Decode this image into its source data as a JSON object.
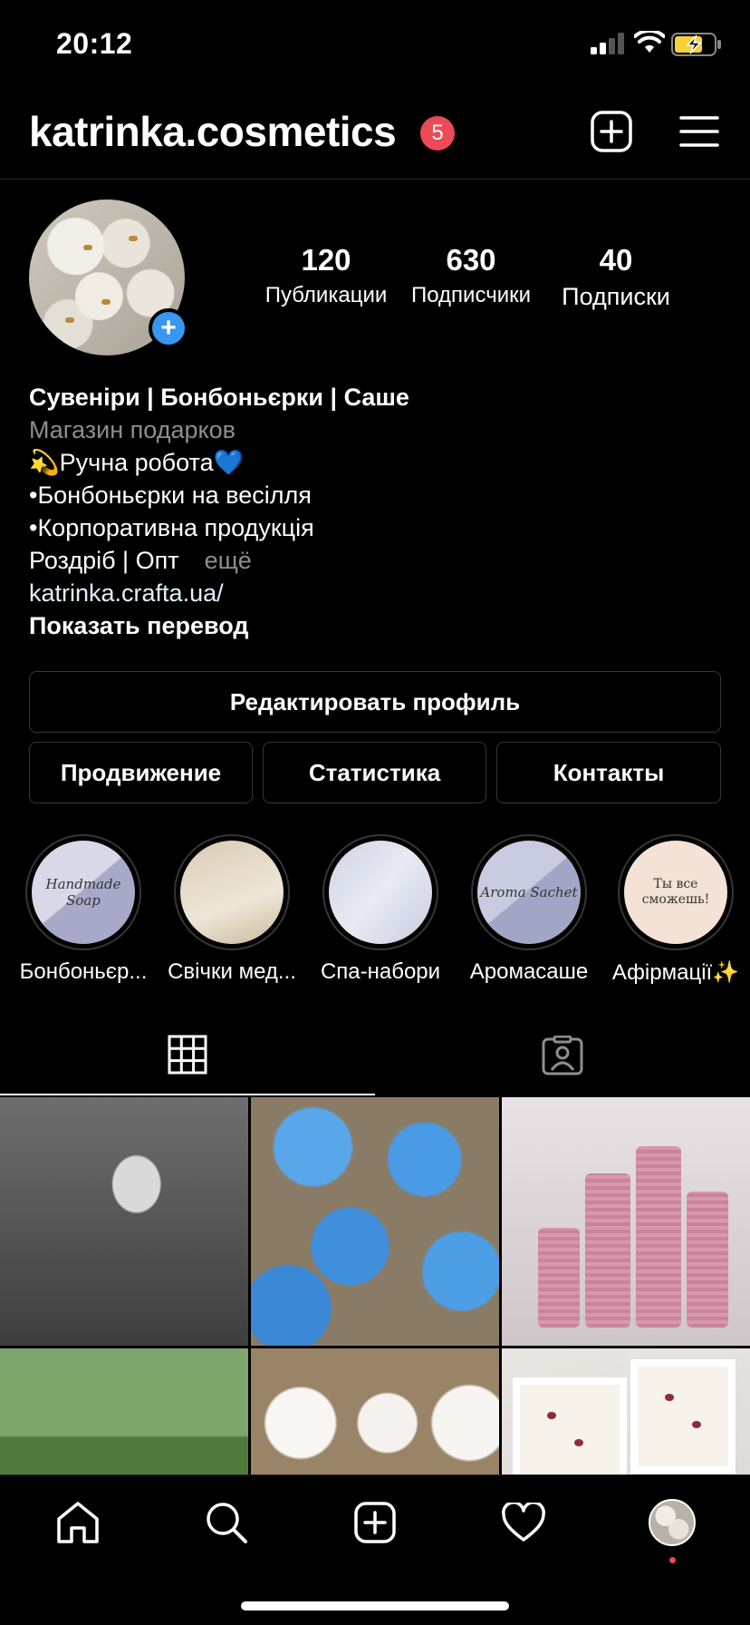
{
  "status_bar": {
    "time": "20:12"
  },
  "header": {
    "username": "katrinka.cosmetics",
    "notification_count": "5"
  },
  "stats": [
    {
      "value": "120",
      "label": "Публикации"
    },
    {
      "value": "630",
      "label": "Подписчики"
    },
    {
      "value": "40",
      "label": "Подписки"
    }
  ],
  "bio": {
    "name": "Сувеніри | Бонбоньєрки | Саше",
    "category": "Магазин подарков",
    "lines": [
      "💫Ручна робота💙",
      "•Бонбоньєрки на весілля",
      "•Корпоративна продукція",
      "Роздріб | Опт"
    ],
    "more": "ещё",
    "link": "katrinka.crafta.ua/",
    "translate": "Показать перевод"
  },
  "buttons": {
    "edit_profile": "Редактировать профиль",
    "promotion": "Продвижение",
    "statistics": "Статистика",
    "contacts": "Контакты"
  },
  "highlights": [
    {
      "label": "Бонбоньєр...",
      "cover_text": "Handmade Soap"
    },
    {
      "label": "Свічки мед...",
      "cover_text": ""
    },
    {
      "label": "Спа-набори",
      "cover_text": ""
    },
    {
      "label": "Аромасаше",
      "cover_text": "Aroma Sachet"
    },
    {
      "label": "Афірмації✨",
      "cover_text": "Ты все сможешь!"
    }
  ],
  "tabs": {
    "grid_icon": "grid-icon",
    "tagged_icon": "tagged-icon"
  },
  "nav": [
    "home-icon",
    "search-icon",
    "add-icon",
    "heart-icon",
    "profile-avatar"
  ],
  "colors": {
    "badge": "#ed4956",
    "accent": "#3897f0",
    "background": "#000000"
  }
}
